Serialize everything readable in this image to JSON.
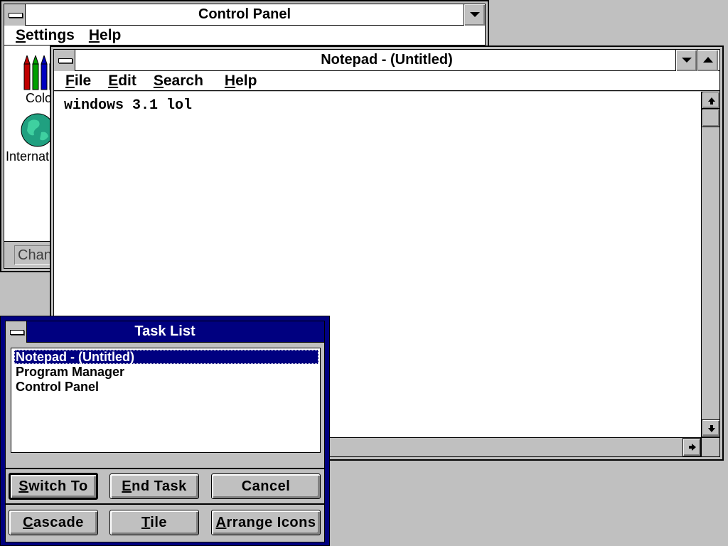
{
  "control_panel": {
    "title": "Control Panel",
    "menu": [
      {
        "first": "S",
        "rest": "ettings"
      },
      {
        "first": "H",
        "rest": "elp"
      }
    ],
    "icons": [
      {
        "label": "Color",
        "icon": "crayons-icon"
      },
      {
        "label": "International",
        "icon": "globe-icon"
      }
    ],
    "status_text": "Change"
  },
  "notepad": {
    "title": "Notepad - (Untitled)",
    "menu": [
      {
        "first": "F",
        "rest": "ile"
      },
      {
        "first": "E",
        "rest": "dit"
      },
      {
        "first": "S",
        "rest": "earch"
      },
      {
        "first": "H",
        "rest": "elp"
      }
    ],
    "text": "windows 3.1 lol"
  },
  "task_list": {
    "title": "Task List",
    "items": [
      {
        "label": "Notepad - (Untitled)",
        "selected": true
      },
      {
        "label": "Program Manager",
        "selected": false
      },
      {
        "label": "Control Panel",
        "selected": false
      }
    ],
    "buttons_row1": [
      {
        "first": "S",
        "rest": "witch To"
      },
      {
        "first": "E",
        "rest": "nd Task"
      },
      {
        "first": "",
        "rest": "Cancel"
      }
    ],
    "buttons_row2": [
      {
        "first": "C",
        "rest": "ascade"
      },
      {
        "first": "T",
        "rest": "ile"
      },
      {
        "first": "A",
        "rest": "rrange Icons"
      }
    ]
  },
  "colors": {
    "desktop": "#c0c0c0",
    "active_title": "#000080",
    "globe": "#20a080"
  }
}
